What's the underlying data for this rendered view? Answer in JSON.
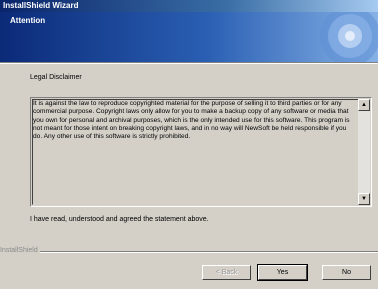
{
  "window": {
    "title": "InstallShield Wizard"
  },
  "banner": {
    "heading": "Attention"
  },
  "dialog": {
    "section_label": "Legal Disclaimer",
    "disclaimer_text": "It is against the law to reproduce copyrighted material for the purpose of selling it to third parties or for any commercial purpose. Copyright laws only allow for you to make a backup copy of any software or media that you own for personal and archival purposes, which is the only intended use for this software. This program is not meant for those intent on breaking copyright laws, and in no way will NewSoft be held responsible if you do. Any other use of this software is strictly prohibited.",
    "agree_text": "I have read, understood and agreed the statement above."
  },
  "footer": {
    "brand": "InstallShield",
    "back_label": "< Back",
    "yes_label": "Yes",
    "no_label": "No"
  },
  "icons": {
    "scroll_up": "scroll-up-arrow-icon",
    "scroll_down": "scroll-down-arrow-icon"
  }
}
